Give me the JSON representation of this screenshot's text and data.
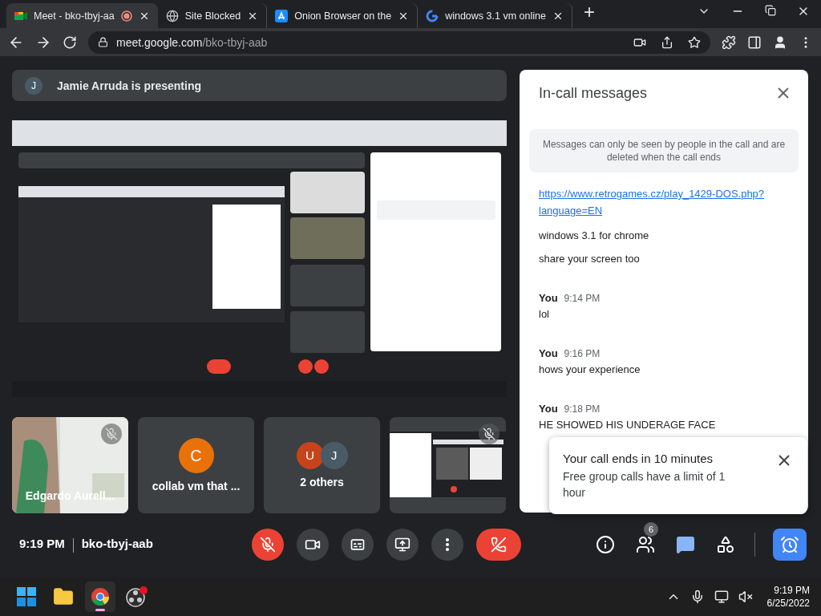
{
  "browser": {
    "tabs": [
      {
        "kind": "meet",
        "title": "Meet - bko-tbyj-aa",
        "recording": true,
        "selected": true
      },
      {
        "kind": "globe",
        "title": "Site Blocked",
        "recording": false,
        "selected": false
      },
      {
        "kind": "store",
        "title": "Onion Browser on the",
        "recording": false,
        "selected": false
      },
      {
        "kind": "google",
        "title": "windows 3.1 vm online",
        "recording": false,
        "selected": false
      }
    ],
    "new_tab": "+",
    "address": {
      "host": "meet.google.com",
      "path": "/bko-tbyj-aab"
    }
  },
  "presenter_banner": {
    "initial": "J",
    "text": "Jamie Arruda is presenting"
  },
  "tiles": [
    {
      "kind": "video",
      "name": "Edgardo Aurell...",
      "muted": true
    },
    {
      "kind": "avatar",
      "name": "collab vm that ...",
      "avatars": [
        {
          "initial": "C",
          "color": "#e8710a"
        }
      ],
      "muted": false
    },
    {
      "kind": "group",
      "name": "2 others",
      "avatars": [
        {
          "initial": "U",
          "color": "#c5441c"
        },
        {
          "initial": "J",
          "color": "#4a5b68"
        }
      ],
      "muted": false
    },
    {
      "kind": "self",
      "muted": true
    }
  ],
  "meeting": {
    "time": "9:19 PM",
    "code": "bko-tbyj-aab"
  },
  "controls": [
    {
      "kind": "mic",
      "on": false
    },
    {
      "kind": "camera",
      "on": true
    },
    {
      "kind": "captions"
    },
    {
      "kind": "present"
    },
    {
      "kind": "more"
    },
    {
      "kind": "leave"
    }
  ],
  "side_controls": [
    {
      "kind": "info",
      "selected": false
    },
    {
      "kind": "people",
      "badge": "6",
      "selected": false
    },
    {
      "kind": "chat",
      "selected": true
    },
    {
      "kind": "activities",
      "selected": false
    },
    {
      "kind": "timer",
      "selected": true
    }
  ],
  "chat_panel": {
    "title": "In-call messages",
    "notice": "Messages can only be seen by people in the call and are deleted when the call ends",
    "groups": [
      {
        "messages": [
          {
            "kind": "link",
            "text": "https://www.retrogames.cz/play_1429-DOS.php?language=EN"
          },
          {
            "kind": "text",
            "text": "windows 3.1 for chrome"
          },
          {
            "kind": "text",
            "text": "share your screen too"
          }
        ]
      },
      {
        "sender": "You",
        "time": "9:14 PM",
        "messages": [
          {
            "kind": "text",
            "text": "lol"
          }
        ]
      },
      {
        "sender": "You",
        "time": "9:16 PM",
        "messages": [
          {
            "kind": "text",
            "text": "hows your experience"
          }
        ]
      },
      {
        "sender": "You",
        "time": "9:18 PM",
        "messages": [
          {
            "kind": "text",
            "text": "HE SHOWED HIS UNDERAGE FACE"
          }
        ]
      }
    ]
  },
  "toast": {
    "title": "Your call ends in 10 minutes",
    "body": "Free group calls have a limit of 1 hour"
  },
  "taskbar": {
    "apps": [
      {
        "kind": "start",
        "selected": false
      },
      {
        "kind": "files",
        "selected": false
      },
      {
        "kind": "chrome",
        "selected": true
      },
      {
        "kind": "obs",
        "selected": false
      }
    ],
    "time": "9:19 PM",
    "date": "6/25/2022"
  }
}
